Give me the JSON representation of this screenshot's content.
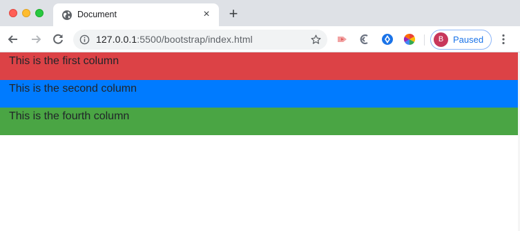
{
  "window": {
    "controls": [
      "close",
      "minimize",
      "zoom"
    ]
  },
  "tab": {
    "title": "Document",
    "favicon": "globe-icon"
  },
  "toolbar": {
    "url_host": "127.0.0.1",
    "url_path": ":5500/bootstrap/index.html",
    "profile": {
      "initial": "B",
      "label": "Paused"
    },
    "extensions": [
      "cast-ext-icon",
      "ahrefs-ext-icon",
      "metamask-ext-icon",
      "color-wheel-ext-icon"
    ]
  },
  "columns": [
    {
      "text": "This is the first column",
      "color": "#dc4246"
    },
    {
      "text": "This is the second column",
      "color": "#007bff"
    },
    {
      "text": "This is the fourth column",
      "color": "#4aa544"
    }
  ],
  "colors": {
    "tabstrip": "#dee1e6",
    "accent": "#1a73e8",
    "avatar": "#c8375b"
  }
}
